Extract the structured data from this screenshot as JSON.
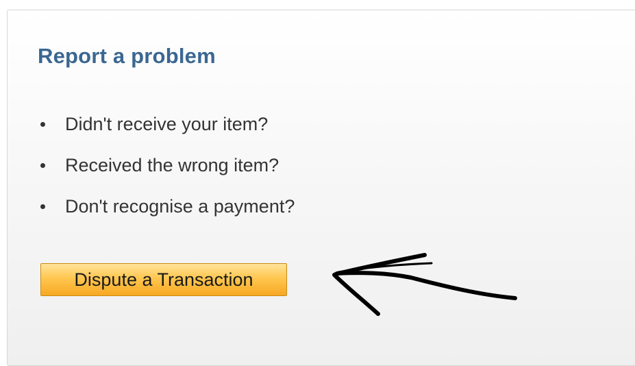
{
  "report_panel": {
    "title": "Report a problem",
    "problems": [
      "Didn't receive your item?",
      "Received the wrong item?",
      "Don't recognise a payment?"
    ],
    "dispute_button_label": "Dispute a Transaction"
  },
  "colors": {
    "title": "#3b6791",
    "text": "#333333",
    "button_top": "#ffe39a",
    "button_bottom": "#f7a823",
    "annotation": "#000000"
  },
  "annotation": {
    "icon": "hand-drawn-arrow-icon"
  }
}
